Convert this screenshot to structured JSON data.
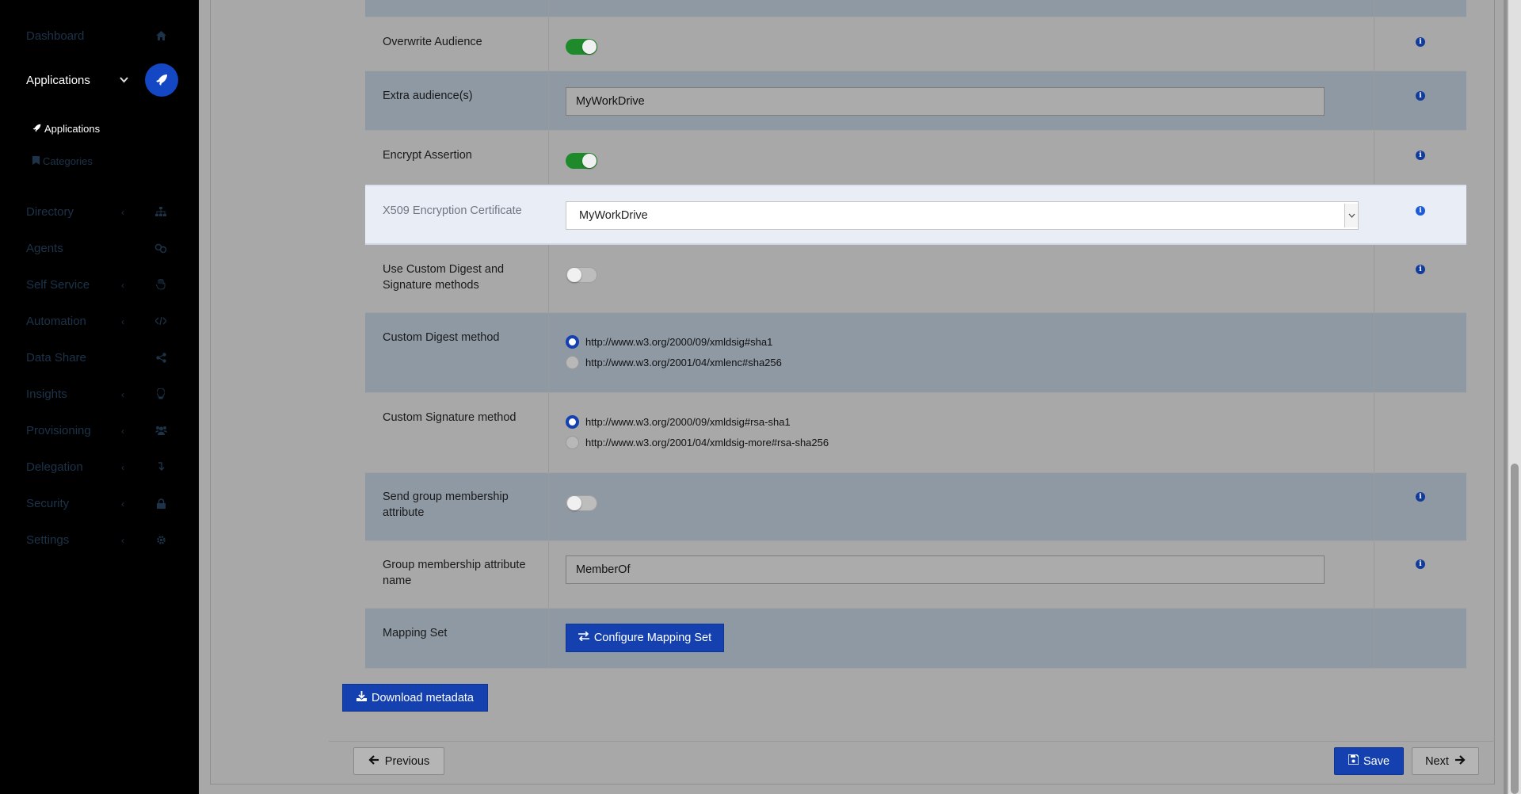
{
  "sidebar": {
    "items": [
      {
        "label": "Dashboard",
        "icon": "home-icon",
        "has_chevron": false
      },
      {
        "label": "Applications",
        "icon": "rocket-icon",
        "has_chevron": true,
        "active": true
      },
      {
        "label": "Directory",
        "icon": "sitemap-icon",
        "has_chevron": true
      },
      {
        "label": "Agents",
        "icon": "agents-icon",
        "has_chevron": false
      },
      {
        "label": "Self Service",
        "icon": "hand-icon",
        "has_chevron": true
      },
      {
        "label": "Automation",
        "icon": "code-icon",
        "has_chevron": true
      },
      {
        "label": "Data Share",
        "icon": "share-icon",
        "has_chevron": false
      },
      {
        "label": "Insights",
        "icon": "lightbulb-icon",
        "has_chevron": true
      },
      {
        "label": "Provisioning",
        "icon": "users-icon",
        "has_chevron": true
      },
      {
        "label": "Delegation",
        "icon": "delegation-icon",
        "has_chevron": true
      },
      {
        "label": "Security",
        "icon": "lock-icon",
        "has_chevron": true
      },
      {
        "label": "Settings",
        "icon": "gear-icon",
        "has_chevron": true
      }
    ],
    "subitems": [
      {
        "label": "Applications",
        "icon": "rocket-icon",
        "current": true
      },
      {
        "label": "Categories",
        "icon": "bookmark-icon",
        "current": false
      }
    ]
  },
  "form": {
    "rows": [
      {
        "label": "Overwrite Audience",
        "type": "toggle",
        "value": "on",
        "info": true
      },
      {
        "label": "Extra audience(s)",
        "type": "text",
        "value": "MyWorkDrive",
        "info": true
      },
      {
        "label": "Encrypt Assertion",
        "type": "toggle",
        "value": "on",
        "info": true
      },
      {
        "label": "X509 Encryption Certificate",
        "type": "select",
        "value": "MyWorkDrive",
        "info": true
      },
      {
        "label": "Use Custom Digest and Signature methods",
        "type": "toggle",
        "value": "off",
        "info": true
      },
      {
        "label": "Custom Digest method",
        "type": "radio",
        "options": [
          "http://www.w3.org/2000/09/xmldsig#sha1",
          "http://www.w3.org/2001/04/xmlenc#sha256"
        ],
        "selected": 0,
        "info": false
      },
      {
        "label": "Custom Signature method",
        "type": "radio",
        "options": [
          "http://www.w3.org/2000/09/xmldsig#rsa-sha1",
          "http://www.w3.org/2001/04/xmldsig-more#rsa-sha256"
        ],
        "selected": 0,
        "info": false
      },
      {
        "label": "Send group membership attribute",
        "type": "toggle",
        "value": "off",
        "info": true
      },
      {
        "label": "Group membership attribute name",
        "type": "text",
        "value": "MemberOf",
        "info": true
      },
      {
        "label": "Mapping Set",
        "type": "button",
        "value": "Configure Mapping Set",
        "info": false
      }
    ]
  },
  "buttons": {
    "download_metadata": "Download metadata",
    "previous": "Previous",
    "save": "Save",
    "next": "Next"
  },
  "colors": {
    "primary": "#1440b0",
    "toggle_on": "#1f8a2c",
    "highlight_row": "#e9eef6"
  }
}
